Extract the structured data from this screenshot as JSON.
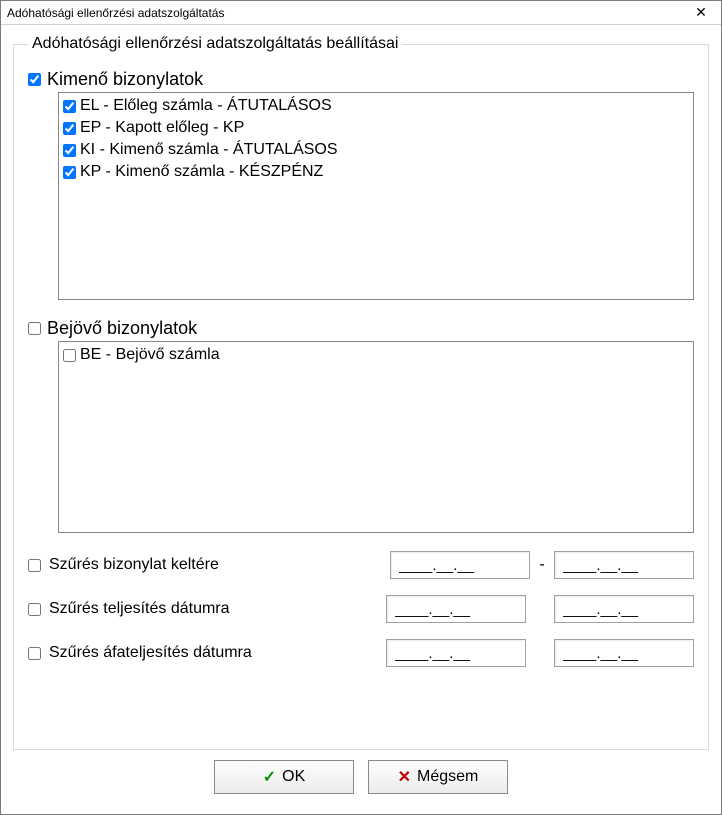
{
  "window": {
    "title": "Adóhatósági ellenőrzési adatszolgáltatás"
  },
  "groupbox": {
    "legend": "Adóhatósági ellenőrzési adatszolgáltatás beállításai"
  },
  "outgoing": {
    "label": "Kimenő bizonylatok",
    "checked": true,
    "items": [
      {
        "label": "EL - Előleg számla - ÁTUTALÁSOS",
        "checked": true
      },
      {
        "label": "EP - Kapott előleg - KP",
        "checked": true
      },
      {
        "label": "KI - Kimenő számla - ÁTUTALÁSOS",
        "checked": true
      },
      {
        "label": "KP - Kimenő számla - KÉSZPÉNZ",
        "checked": true
      }
    ]
  },
  "incoming": {
    "label": "Bejövő bizonylatok",
    "checked": false,
    "items": [
      {
        "label": "BE - Bejövő számla",
        "checked": false
      }
    ]
  },
  "filters": {
    "kelt": {
      "label": "Szűrés bizonylat keltére",
      "checked": false,
      "from": "____.__.__",
      "to": "____.__.__",
      "sep": "-"
    },
    "teljesites": {
      "label": "Szűrés teljesítés dátumra",
      "checked": false,
      "from": "____.__.__",
      "to": "____.__.__"
    },
    "afateljesites": {
      "label": "Szűrés áfateljesítés dátumra",
      "checked": false,
      "from": "____.__.__",
      "to": "____.__.__"
    }
  },
  "buttons": {
    "ok": "OK",
    "cancel": "Mégsem"
  }
}
